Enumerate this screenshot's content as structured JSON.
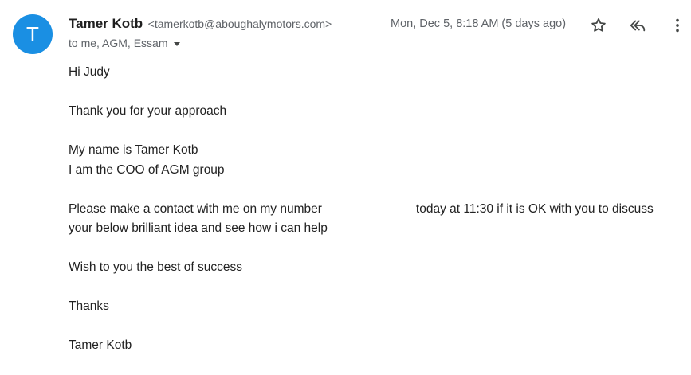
{
  "sender": {
    "avatar_letter": "T",
    "avatar_color": "#1a8fe3",
    "name": "Tamer Kotb",
    "email": "<tamerkotb@aboughalymotors.com>",
    "recipients": "to me, AGM, Essam"
  },
  "meta": {
    "date": "Mon, Dec 5, 8:18 AM (5 days ago)"
  },
  "actions": {
    "star_icon": "star-outline-icon",
    "reply_icon": "reply-all-icon",
    "more_icon": "more-vert-icon"
  },
  "message": {
    "greeting": "Hi Judy",
    "thanks_line": "Thank you for your approach",
    "intro_1": "My name is Tamer Kotb",
    "intro_2": "I am the COO of AGM group",
    "contact_part1": "Please make a contact with me on my number",
    "contact_part2": "today at 11:30 if it is OK with you to discuss",
    "contact_line2": "your below brilliant idea and see how i can help",
    "wish": "Wish to you the best of success",
    "closing": "Thanks",
    "signature": "Tamer Kotb"
  }
}
